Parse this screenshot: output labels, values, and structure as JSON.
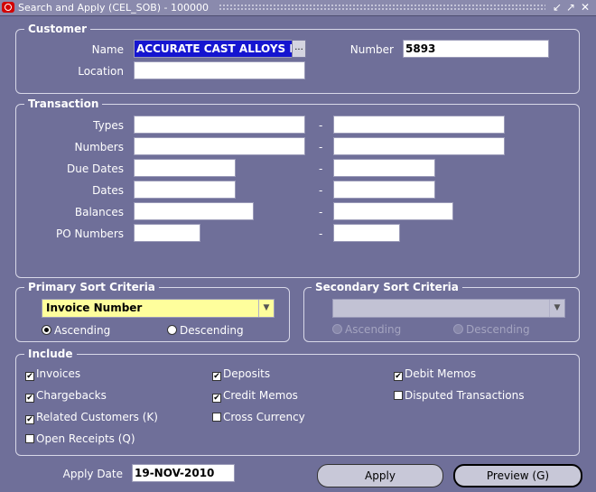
{
  "window": {
    "title": "Search and Apply (CEL_SOB) - 100000",
    "controls": [
      "↙",
      "↗",
      "✕"
    ]
  },
  "customer": {
    "legend": "Customer",
    "name_label": "Name",
    "name_value": "ACCURATE CAST ALLOYS I",
    "lov_label": "...",
    "number_label": "Number",
    "number_value": "5893",
    "location_label": "Location",
    "location_value": ""
  },
  "transaction": {
    "legend": "Transaction",
    "separator": "-",
    "rows": [
      {
        "label": "Types",
        "from": "",
        "to": ""
      },
      {
        "label": "Numbers",
        "from": "",
        "to": ""
      },
      {
        "label": "Due Dates",
        "from": "",
        "to": ""
      },
      {
        "label": "Dates",
        "from": "",
        "to": ""
      },
      {
        "label": "Balances",
        "from": "",
        "to": ""
      },
      {
        "label": "PO Numbers",
        "from": "",
        "to": ""
      }
    ]
  },
  "primary_sort": {
    "legend": "Primary Sort Criteria",
    "selected": "Invoice Number",
    "ascending": "Ascending",
    "descending": "Descending"
  },
  "secondary_sort": {
    "legend": "Secondary Sort Criteria",
    "selected": "",
    "ascending": "Ascending",
    "descending": "Descending"
  },
  "include": {
    "legend": "Include",
    "invoices": "Invoices",
    "chargebacks": "Chargebacks",
    "related_customers": "Related Customers (K)",
    "open_receipts": "Open Receipts (Q)",
    "deposits": "Deposits",
    "credit_memos": "Credit Memos",
    "cross_currency": "Cross Currency",
    "debit_memos": "Debit Memos",
    "disputed_transactions": "Disputed Transactions",
    "check_mark": "✔"
  },
  "footer": {
    "apply_date_label": "Apply Date",
    "apply_date_value": "19-NOV-2010",
    "apply_button": "Apply",
    "preview_button": "Preview (G)"
  },
  "colors": {
    "background": "#6f6f99",
    "title_bar": "#8a8aad",
    "selection": "#1515d0",
    "required_field": "#fefe9c",
    "disabled_field": "#c2c2d4"
  }
}
